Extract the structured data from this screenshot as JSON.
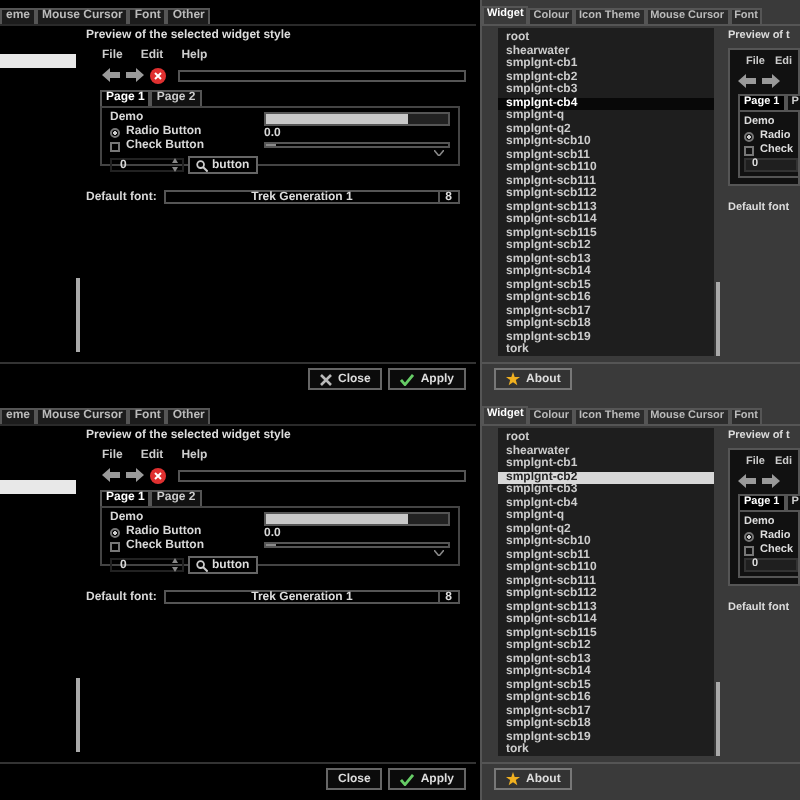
{
  "screens": [
    {
      "dark_dialog": {
        "tabs": [
          {
            "label": "eme",
            "selected": false
          },
          {
            "label": "Mouse Cursor",
            "selected": false
          },
          {
            "label": "Font",
            "selected": false
          },
          {
            "label": "Other",
            "selected": false
          }
        ],
        "theme_list": [
          {
            "selected": false
          },
          {
            "selected": false
          },
          {
            "selected": true
          }
        ],
        "preview_title": "Preview of the selected widget style",
        "menu": [
          "File",
          "Edit",
          "Help"
        ],
        "notebook_tabs": [
          {
            "label": "Page 1",
            "selected": true
          },
          {
            "label": "Page 2",
            "selected": false
          }
        ],
        "frame_label": "Demo",
        "radio": {
          "label": "Radio Button",
          "checked": true
        },
        "check": {
          "label": "Check Button",
          "checked": false
        },
        "spin_value": "0",
        "demo_button": "button",
        "progress": {
          "level": 0.78
        },
        "scale": {
          "reading": "0.0",
          "level": 0.06
        },
        "font_label": "Default font:",
        "font_name": "Trek Generation 1",
        "font_size": "8",
        "buttons": [
          {
            "label": "Close",
            "kind": "cross"
          },
          {
            "label": "Apply",
            "kind": "tick"
          }
        ]
      },
      "grey_dialog": {
        "tabs": [
          {
            "label": "Widget",
            "selected": true
          },
          {
            "label": "Colour",
            "selected": false
          },
          {
            "label": "Icon Theme",
            "selected": false
          },
          {
            "label": "Mouse Cursor",
            "selected": false
          },
          {
            "label": "Font",
            "selected": false
          }
        ],
        "kind": "inverse",
        "items": [
          {
            "label": "root",
            "selected": false
          },
          {
            "label": "shearwater",
            "selected": false
          },
          {
            "label": "smplgnt-cb1",
            "selected": false
          },
          {
            "label": "smplgnt-cb2",
            "selected": false
          },
          {
            "label": "smplgnt-cb3",
            "selected": false
          },
          {
            "label": "smplgnt-cb4",
            "selected": true
          },
          {
            "label": "smplgnt-q",
            "selected": false
          },
          {
            "label": "smplgnt-q2",
            "selected": false
          },
          {
            "label": "smplgnt-scb10",
            "selected": false
          },
          {
            "label": "smplgnt-scb11",
            "selected": false
          },
          {
            "label": "smplgnt-scb110",
            "selected": false
          },
          {
            "label": "smplgnt-scb111",
            "selected": false
          },
          {
            "label": "smplgnt-scb112",
            "selected": false
          },
          {
            "label": "smplgnt-scb113",
            "selected": false
          },
          {
            "label": "smplgnt-scb114",
            "selected": false
          },
          {
            "label": "smplgnt-scb115",
            "selected": false
          },
          {
            "label": "smplgnt-scb12",
            "selected": false
          },
          {
            "label": "smplgnt-scb13",
            "selected": false
          },
          {
            "label": "smplgnt-scb14",
            "selected": false
          },
          {
            "label": "smplgnt-scb15",
            "selected": false
          },
          {
            "label": "smplgnt-scb16",
            "selected": false
          },
          {
            "label": "smplgnt-scb17",
            "selected": false
          },
          {
            "label": "smplgnt-scb18",
            "selected": false
          },
          {
            "label": "smplgnt-scb19",
            "selected": false
          },
          {
            "label": "tork",
            "selected": false
          }
        ],
        "preview_title": "Preview of t",
        "menu": [
          "File",
          "Edi"
        ],
        "notebook_tabs": [
          {
            "label": "Page 1",
            "selected": true
          },
          {
            "label": "P",
            "selected": false
          }
        ],
        "frame_label": "Demo",
        "radio": {
          "label": "Radio",
          "checked": true
        },
        "check": {
          "label": "Check",
          "checked": false
        },
        "spin_value": "0",
        "font_label": "Default font",
        "about_button": "About"
      }
    },
    {
      "dark_dialog": {
        "tabs": [
          {
            "label": "eme",
            "selected": false
          },
          {
            "label": "Mouse Cursor",
            "selected": false
          },
          {
            "label": "Font",
            "selected": false
          },
          {
            "label": "Other",
            "selected": false
          }
        ],
        "theme_list": [
          {
            "selected": false
          },
          {
            "selected": false
          },
          {
            "selected": false
          },
          {
            "selected": false
          },
          {
            "selected": true
          }
        ],
        "preview_title": "Preview of the selected widget style",
        "menu": [
          "File",
          "Edit",
          "Help"
        ],
        "notebook_tabs": [
          {
            "label": "Page 1",
            "selected": true
          },
          {
            "label": "Page 2",
            "selected": false
          }
        ],
        "frame_label": "Demo",
        "radio": {
          "label": "Radio Button",
          "checked": true
        },
        "check": {
          "label": "Check Button",
          "checked": false
        },
        "spin_value": "0",
        "demo_button": "button",
        "progress": {
          "level": 0.78
        },
        "scale": {
          "reading": "0.0",
          "level": 0.06
        },
        "font_label": "Default font:",
        "font_name": "Trek Generation 1",
        "font_size": "8",
        "buttons": [
          {
            "label": "Close",
            "kind": "plain"
          },
          {
            "label": "Apply",
            "kind": "tick"
          }
        ]
      },
      "grey_dialog": {
        "tabs": [
          {
            "label": "Widget",
            "selected": true
          },
          {
            "label": "Colour",
            "selected": false
          },
          {
            "label": "Icon Theme",
            "selected": false
          },
          {
            "label": "Mouse Cursor",
            "selected": false
          },
          {
            "label": "Font",
            "selected": false
          }
        ],
        "kind": "bright",
        "items": [
          {
            "label": "root",
            "selected": false
          },
          {
            "label": "shearwater",
            "selected": false
          },
          {
            "label": "smplgnt-cb1",
            "selected": false
          },
          {
            "label": "smplgnt-cb2",
            "selected": true
          },
          {
            "label": "smplgnt-cb3",
            "selected": false
          },
          {
            "label": "smplgnt-cb4",
            "selected": false
          },
          {
            "label": "smplgnt-q",
            "selected": false
          },
          {
            "label": "smplgnt-q2",
            "selected": false
          },
          {
            "label": "smplgnt-scb10",
            "selected": false
          },
          {
            "label": "smplgnt-scb11",
            "selected": false
          },
          {
            "label": "smplgnt-scb110",
            "selected": false
          },
          {
            "label": "smplgnt-scb111",
            "selected": false
          },
          {
            "label": "smplgnt-scb112",
            "selected": false
          },
          {
            "label": "smplgnt-scb113",
            "selected": false
          },
          {
            "label": "smplgnt-scb114",
            "selected": false
          },
          {
            "label": "smplgnt-scb115",
            "selected": false
          },
          {
            "label": "smplgnt-scb12",
            "selected": false
          },
          {
            "label": "smplgnt-scb13",
            "selected": false
          },
          {
            "label": "smplgnt-scb14",
            "selected": false
          },
          {
            "label": "smplgnt-scb15",
            "selected": false
          },
          {
            "label": "smplgnt-scb16",
            "selected": false
          },
          {
            "label": "smplgnt-scb17",
            "selected": false
          },
          {
            "label": "smplgnt-scb18",
            "selected": false
          },
          {
            "label": "smplgnt-scb19",
            "selected": false
          },
          {
            "label": "tork",
            "selected": false
          }
        ],
        "preview_title": "Preview of t",
        "menu": [
          "File",
          "Edi"
        ],
        "notebook_tabs": [
          {
            "label": "Page 1",
            "selected": true
          },
          {
            "label": "P",
            "selected": false
          }
        ],
        "frame_label": "Demo",
        "radio": {
          "label": "Radio",
          "checked": true
        },
        "check": {
          "label": "Check",
          "checked": false
        },
        "spin_value": "0",
        "font_label": "Default font",
        "about_button": "About"
      }
    }
  ]
}
